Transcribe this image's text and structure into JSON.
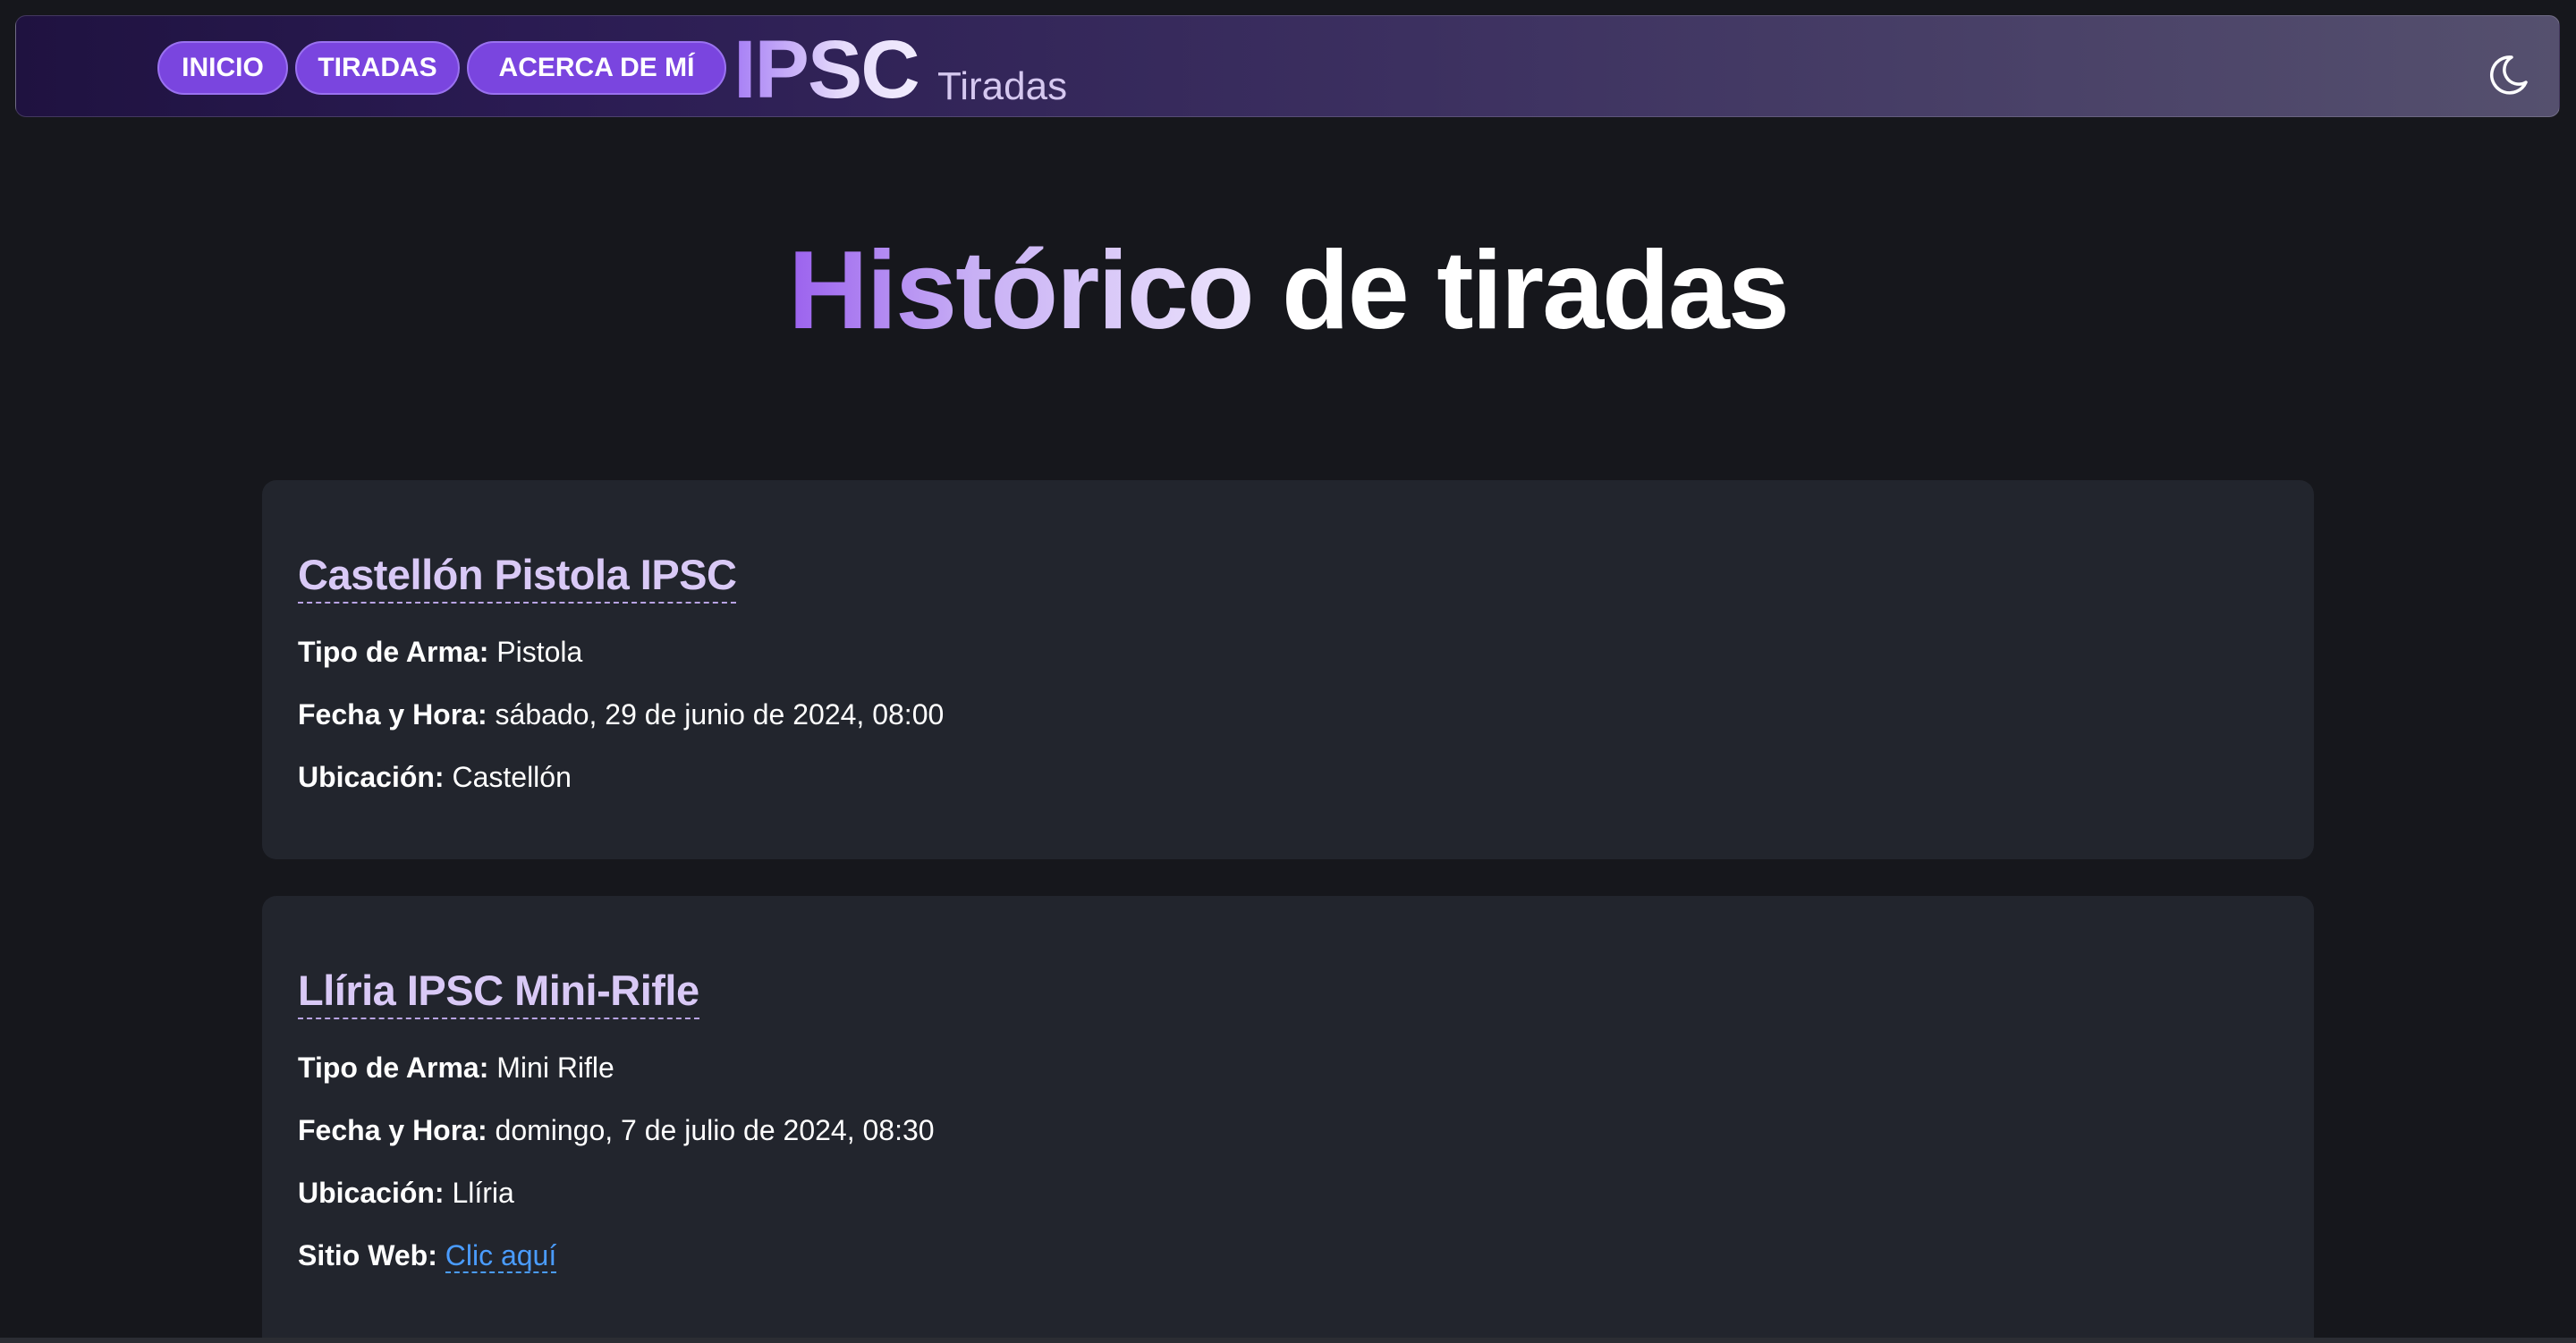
{
  "nav": {
    "links": [
      "INICIO",
      "TIRADAS",
      "ACERCA DE MÍ"
    ],
    "brand": "IPSC",
    "brand_sub": "Tiradas",
    "theme_icon": "moon-icon"
  },
  "hero": {
    "title_accent": "Histórico",
    "title_rest": " de tiradas"
  },
  "cards": [
    {
      "title": "Castellón Pistola IPSC",
      "tipo_label": "Tipo de Arma:",
      "tipo_value": " Pistola",
      "fecha_label": "Fecha y Hora:",
      "fecha_value": " sábado, 29 de junio de 2024, 08:00",
      "ubicacion_label": "Ubicación:",
      "ubicacion_value": " Castellón"
    },
    {
      "title": "Llíria IPSC Mini-Rifle",
      "tipo_label": "Tipo de Arma:",
      "tipo_value": " Mini Rifle",
      "fecha_label": "Fecha y Hora:",
      "fecha_value": " domingo, 7 de julio de 2024, 08:30",
      "ubicacion_label": "Ubicación:",
      "ubicacion_value": " Llíria",
      "web_label": "Sitio Web:",
      "web_link": "Clic aquí"
    }
  ],
  "colors": {
    "background": "#16171c",
    "card": "#22252d",
    "pill": "#7a45df",
    "link": "#4a9cff",
    "card_title": "#d9c9f6"
  }
}
